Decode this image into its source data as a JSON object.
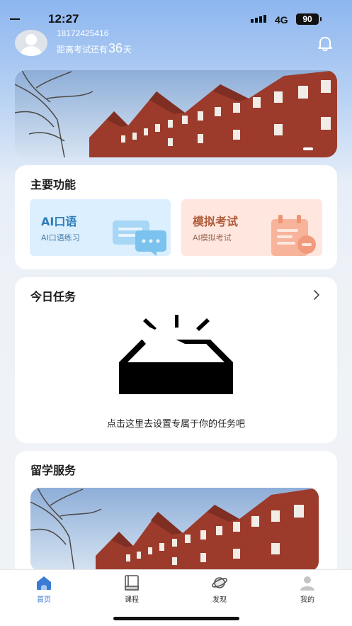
{
  "status_bar": {
    "time": "12:27",
    "network": "4G",
    "battery": "90"
  },
  "user": {
    "phone": "18172425416",
    "countdown_prefix": "距离考试还有",
    "countdown_days": "36",
    "countdown_suffix": "天"
  },
  "features": {
    "title": "主要功能",
    "items": [
      {
        "title": "AI口语",
        "subtitle": "AI口语练习",
        "icon": "chat-bubbles-icon",
        "bg": "#dcefff"
      },
      {
        "title": "模拟考试",
        "subtitle": "AI模拟考试",
        "icon": "exam-paper-icon",
        "bg": "#ffe7df"
      }
    ]
  },
  "tasks": {
    "title": "今日任务",
    "empty_text": "点击这里去设置专属于你的任务吧"
  },
  "service": {
    "title": "留学服务"
  },
  "tabbar": {
    "items": [
      {
        "label": "首页",
        "icon": "home-icon",
        "active": true
      },
      {
        "label": "课程",
        "icon": "book-icon",
        "active": false
      },
      {
        "label": "发现",
        "icon": "planet-icon",
        "active": false
      },
      {
        "label": "我的",
        "icon": "profile-icon",
        "active": false
      }
    ]
  },
  "colors": {
    "accent": "#3a7bd5",
    "brick": "#9c3b2c",
    "sky": "#b7cdea"
  }
}
